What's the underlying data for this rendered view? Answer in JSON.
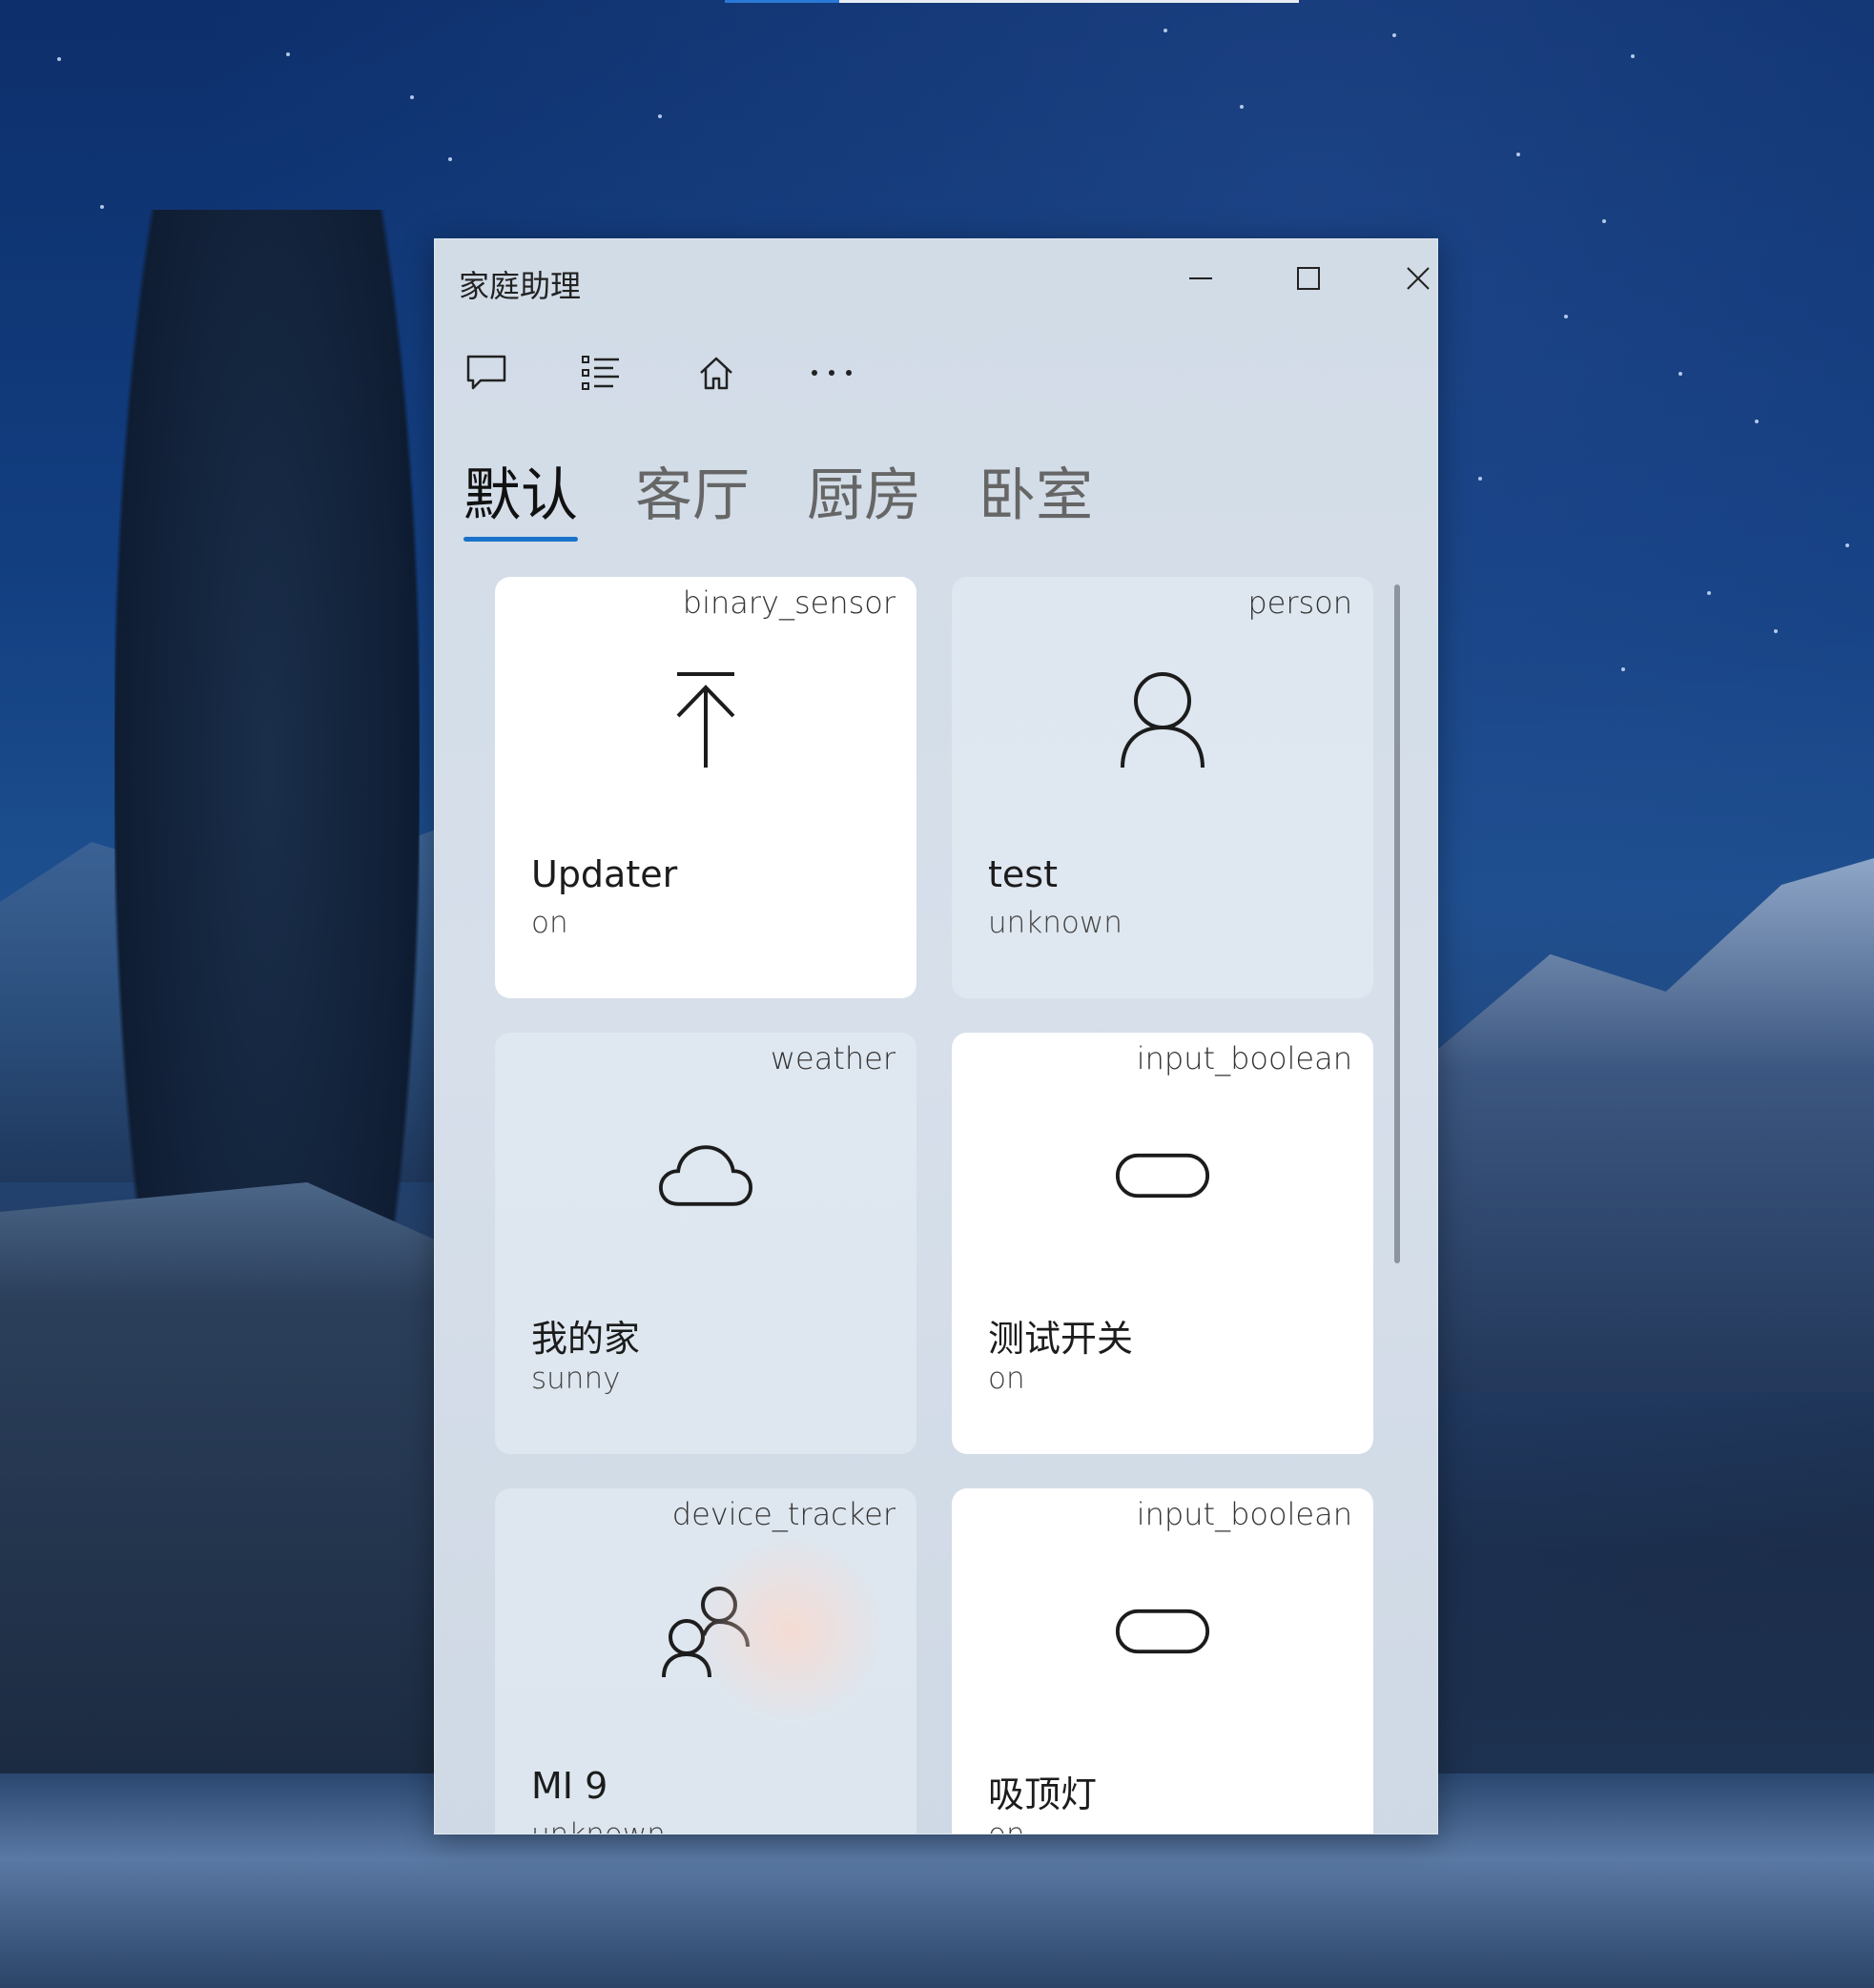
{
  "window": {
    "title": "家庭助理",
    "controls": {
      "minimize": "minimize",
      "maximize": "maximize",
      "close": "close"
    }
  },
  "toolbar": {
    "icons": [
      "chat-icon",
      "list-icon",
      "home-icon",
      "more-icon"
    ],
    "more_label": "···"
  },
  "tabs": [
    {
      "label": "默认",
      "active": true
    },
    {
      "label": "客厅",
      "active": false
    },
    {
      "label": "厨房",
      "active": false
    },
    {
      "label": "卧室",
      "active": false
    }
  ],
  "cards": [
    {
      "type": "binary_sensor",
      "icon": "upload-arrow-icon",
      "name": "Updater",
      "state": "on"
    },
    {
      "type": "person",
      "icon": "person-icon",
      "name": "test",
      "state": "unknown"
    },
    {
      "type": "weather",
      "icon": "cloud-icon",
      "name": "我的家",
      "state": "sunny"
    },
    {
      "type": "input_boolean",
      "icon": "toggle-icon",
      "name": "测试开关",
      "state": "on"
    },
    {
      "type": "device_tracker",
      "icon": "people-icon",
      "name": "MI 9",
      "state": "unknown"
    },
    {
      "type": "input_boolean",
      "icon": "toggle-icon",
      "name": "吸顶灯",
      "state": "on"
    }
  ],
  "colors": {
    "accent": "#1a73c9",
    "window_bg": "#d4dde8",
    "card_active": "#ffffff",
    "card_inactive": "#e2e9f2"
  }
}
